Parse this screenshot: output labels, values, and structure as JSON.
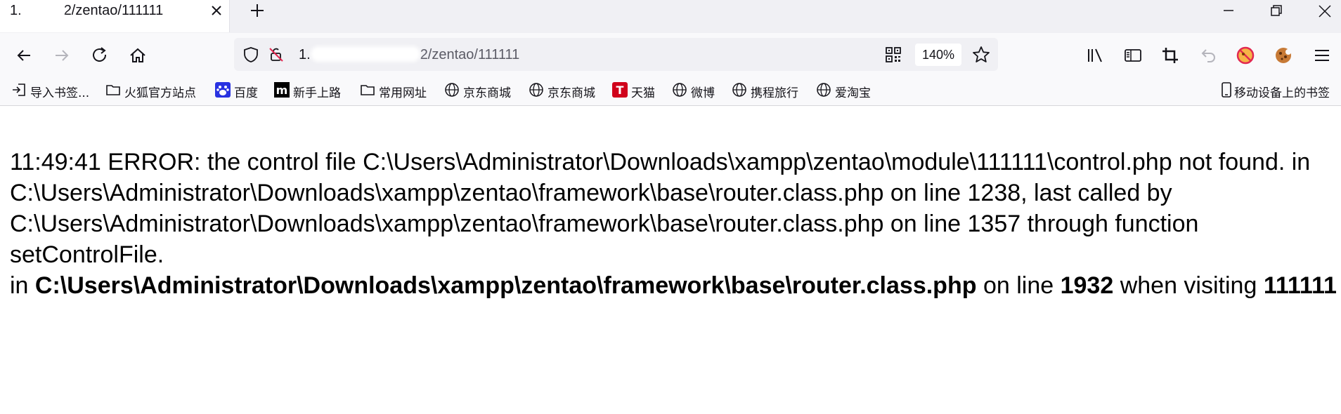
{
  "tab": {
    "title_prefix": "1.",
    "title_suffix": "2/zentao/111111",
    "close": "×"
  },
  "window": {
    "minimize": "minimize",
    "restore": "restore",
    "close": "close"
  },
  "url": {
    "host_prefix": "1.",
    "path": "2/zentao/111111",
    "zoom": "140%"
  },
  "bookmarks": [
    {
      "label": "导入书签...",
      "icon": "import-icon"
    },
    {
      "label": "火狐官方站点",
      "icon": "folder-icon"
    },
    {
      "label": "百度",
      "icon": "baidu-paw-icon"
    },
    {
      "label": "新手上路",
      "icon": "m-logo-icon"
    },
    {
      "label": "常用网址",
      "icon": "folder-icon"
    },
    {
      "label": "京东商城",
      "icon": "globe-icon"
    },
    {
      "label": "京东商城",
      "icon": "globe-icon"
    },
    {
      "label": "天猫",
      "icon": "tmall-icon"
    },
    {
      "label": "微博",
      "icon": "globe-icon"
    },
    {
      "label": "携程旅行",
      "icon": "globe-icon"
    },
    {
      "label": "爱淘宝",
      "icon": "globe-icon"
    }
  ],
  "mobile_bookmarks": "移动设备上的书签",
  "error": {
    "message": "11:49:41 ERROR: the control file C:\\Users\\Administrator\\Downloads\\xampp\\zentao\\module\\111111\\control.php not found. in C:\\Users\\Administrator\\Downloads\\xampp\\zentao\\framework\\base\\router.class.php on line 1238, last called by C:\\Users\\Administrator\\Downloads\\xampp\\zentao\\framework\\base\\router.class.php on line 1357 through function setControlFile.",
    "in_label": "in",
    "file": "C:\\Users\\Administrator\\Downloads\\xampp\\zentao\\framework\\base\\router.class.php",
    "on_line_label": "on line",
    "line": "1932",
    "when_visiting_label": "when visiting",
    "visiting": "111111"
  },
  "colors": {
    "tabbar": "#f0f0f4",
    "toolbar": "#f9f9fb",
    "urlbar": "#f0f0f4",
    "text": "#000000"
  }
}
